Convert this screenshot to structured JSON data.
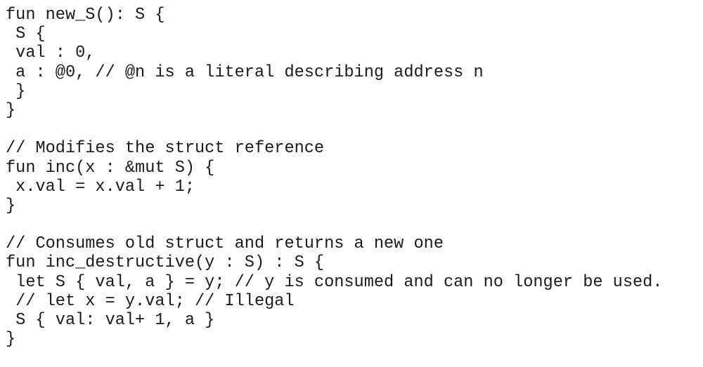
{
  "document": {
    "kind": "code-listing",
    "language": "Move",
    "background_color": "#ffffff",
    "text_color": "#1b1b1b",
    "font_style": "monospace",
    "blocks": [
      {
        "name": "new_S-constructor",
        "heading_comment": null,
        "lines": [
          "fun new_S(): S {",
          " S {",
          " val : 0,",
          " a : @0, // @n is a literal describing address n",
          " }",
          "}"
        ]
      },
      {
        "name": "inc-mutable-reference",
        "heading_comment": "// Modifies the struct reference",
        "lines": [
          "// Modifies the struct reference",
          "fun inc(x : &mut S) {",
          " x.val = x.val + 1;",
          "}"
        ]
      },
      {
        "name": "inc_destructive-consuming",
        "heading_comment": "// Consumes old struct and returns a new one",
        "lines": [
          "// Consumes old struct and returns a new one",
          "fun inc_destructive(y : S) : S {",
          " let S { val, a } = y; // y is consumed and can no longer be used.",
          " // let x = y.val; // Illegal",
          " S { val: val+ 1, a }",
          "}"
        ]
      }
    ],
    "all_lines": [
      "fun new_S(): S {",
      " S {",
      " val : 0,",
      " a : @0, // @n is a literal describing address n",
      " }",
      "}",
      "",
      "// Modifies the struct reference",
      "fun inc(x : &mut S) {",
      " x.val = x.val + 1;",
      "}",
      "",
      "// Consumes old struct and returns a new one",
      "fun inc_destructive(y : S) : S {",
      " let S { val, a } = y; // y is consumed and can no longer be used.",
      " // let x = y.val; // Illegal",
      " S { val: val+ 1, a }",
      "}"
    ]
  }
}
